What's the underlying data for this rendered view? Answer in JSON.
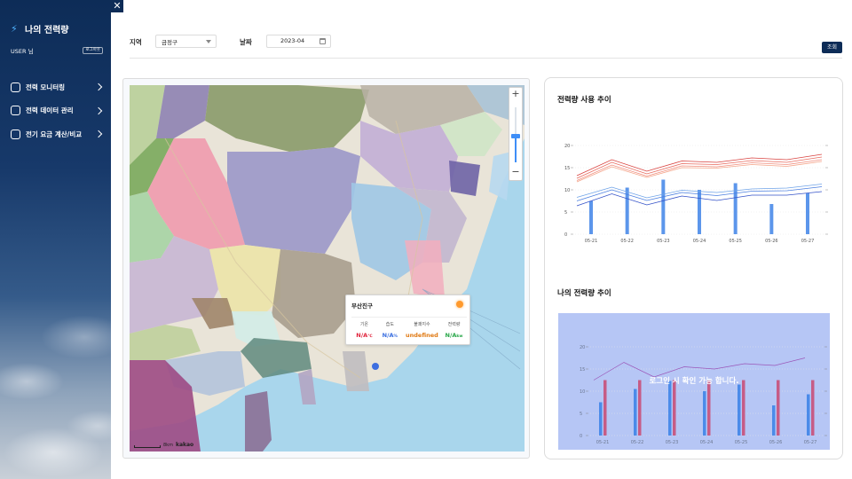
{
  "app": {
    "title": "나의 전력량",
    "user_label": "USER 님",
    "logout_label": "로그아웃",
    "close_glyph": "✕"
  },
  "nav": [
    {
      "label": "전력 모니터링",
      "icon": "monitor-icon"
    },
    {
      "label": "전력 데이터 관리",
      "icon": "data-icon"
    },
    {
      "label": "전기 요금 계산/비교",
      "icon": "calculator-icon"
    }
  ],
  "filter": {
    "region_label": "지역",
    "region_value": "금정구",
    "date_label": "날짜",
    "date_value": "2023-04",
    "query_label": "조회"
  },
  "map": {
    "zoom_in": "+",
    "zoom_out": "−",
    "scale_label": "8km",
    "brand": "kakao",
    "popup": {
      "title": "부산진구",
      "headers": [
        "기온",
        "습도",
        "불쾌지수",
        "전력량"
      ],
      "values": [
        "N/A",
        "N/A",
        "undefined",
        "N/A"
      ],
      "units": [
        "℃",
        "%",
        "",
        "kw"
      ],
      "colors": [
        "#e0243c",
        "#3a6fe0",
        "#e07a14",
        "#2aa84a"
      ]
    }
  },
  "colors": {
    "navy": "#0d2c57",
    "accent": "#3e8ef7"
  },
  "charts": {
    "usage_title": "전력량 사용 추이",
    "mine_title": "나의 전력량 추이",
    "login_message": "로그인 시 확인 가능 합니다."
  },
  "chart_data": [
    {
      "type": "line",
      "title": "전력량 사용 추이",
      "categories": [
        "05-21",
        "05-22",
        "05-23",
        "05-24",
        "05-25",
        "05-26",
        "05-27"
      ],
      "yticks": [
        0,
        5,
        10,
        15,
        20
      ],
      "ylim": [
        0,
        20
      ],
      "bars": [
        7.5,
        10.5,
        12.3,
        10,
        11.5,
        6.8,
        9.3
      ],
      "series": [
        {
          "color": "#d9423f",
          "values": [
            13.2,
            16.8,
            14.2,
            16.5,
            16.2,
            17.2,
            16.8,
            18.0
          ]
        },
        {
          "color": "#e86a5e",
          "values": [
            12.6,
            16.2,
            13.6,
            15.9,
            15.7,
            16.6,
            16.2,
            17.4
          ]
        },
        {
          "color": "#f19080",
          "values": [
            12.1,
            15.6,
            13.1,
            15.4,
            15.2,
            16.1,
            15.7,
            16.8
          ]
        },
        {
          "color": "#f4a58a",
          "values": [
            11.8,
            15.2,
            12.8,
            15.0,
            14.9,
            15.7,
            15.3,
            16.4
          ]
        },
        {
          "color": "#6fa3e8",
          "values": [
            8.3,
            10.6,
            8.2,
            9.9,
            9.4,
            10.2,
            10.4,
            11.3
          ]
        },
        {
          "color": "#4a7ee0",
          "values": [
            7.5,
            10.0,
            7.6,
            9.4,
            8.7,
            9.7,
            9.8,
            10.7
          ]
        },
        {
          "color": "#3452c8",
          "values": [
            6.4,
            9.1,
            6.6,
            8.6,
            7.6,
            8.8,
            8.8,
            9.6
          ]
        }
      ]
    },
    {
      "type": "bar",
      "title": "나의 전력량 추이",
      "categories": [
        "05-21",
        "05-22",
        "05-23",
        "05-24",
        "05-25",
        "05-26",
        "05-27"
      ],
      "yticks": [
        0,
        5,
        10,
        15,
        20
      ],
      "ylim": [
        0,
        20
      ],
      "series": [
        {
          "color": "#3f84e8",
          "values": [
            7.5,
            10.5,
            12.3,
            10,
            11.5,
            6.8,
            9.3
          ]
        },
        {
          "color": "#c8507a",
          "values": [
            12.5,
            12.5,
            12.5,
            12.5,
            12.5,
            12.5,
            12.5
          ]
        }
      ],
      "line": [
        12.5,
        16.5,
        13.2,
        15.5,
        15.0,
        16.2,
        15.8,
        17.5
      ]
    }
  ]
}
